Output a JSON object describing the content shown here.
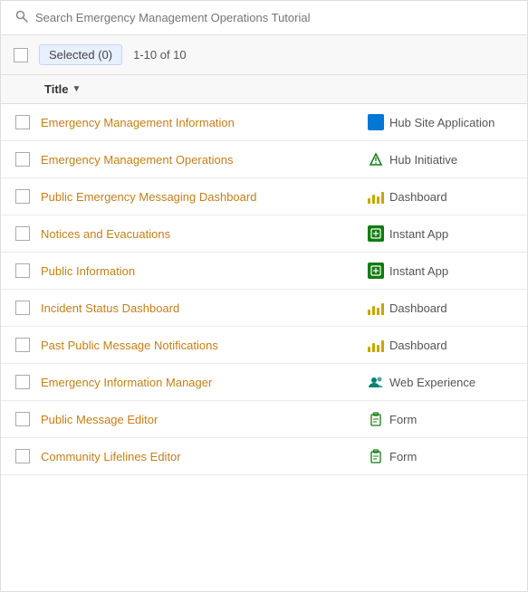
{
  "search": {
    "placeholder": "Search Emergency Management Operations Tutorial"
  },
  "toolbar": {
    "selected_label": "Selected (0)",
    "page_info": "1-10 of 10"
  },
  "table": {
    "column_title": "Title",
    "rows": [
      {
        "title": "Emergency Management Information",
        "type_label": "Hub Site Application",
        "type_key": "hub-site"
      },
      {
        "title": "Emergency Management Operations",
        "type_label": "Hub Initiative",
        "type_key": "hub-initiative"
      },
      {
        "title": "Public Emergency Messaging Dashboard",
        "type_label": "Dashboard",
        "type_key": "dashboard"
      },
      {
        "title": "Notices and Evacuations",
        "type_label": "Instant App",
        "type_key": "instant-app"
      },
      {
        "title": "Public Information",
        "type_label": "Instant App",
        "type_key": "instant-app"
      },
      {
        "title": "Incident Status Dashboard",
        "type_label": "Dashboard",
        "type_key": "dashboard"
      },
      {
        "title": "Past Public Message Notifications",
        "type_label": "Dashboard",
        "type_key": "dashboard"
      },
      {
        "title": "Emergency Information Manager",
        "type_label": "Web Experience",
        "type_key": "web-experience"
      },
      {
        "title": "Public Message Editor",
        "type_label": "Form",
        "type_key": "form"
      },
      {
        "title": "Community Lifelines Editor",
        "type_label": "Form",
        "type_key": "form"
      }
    ]
  }
}
